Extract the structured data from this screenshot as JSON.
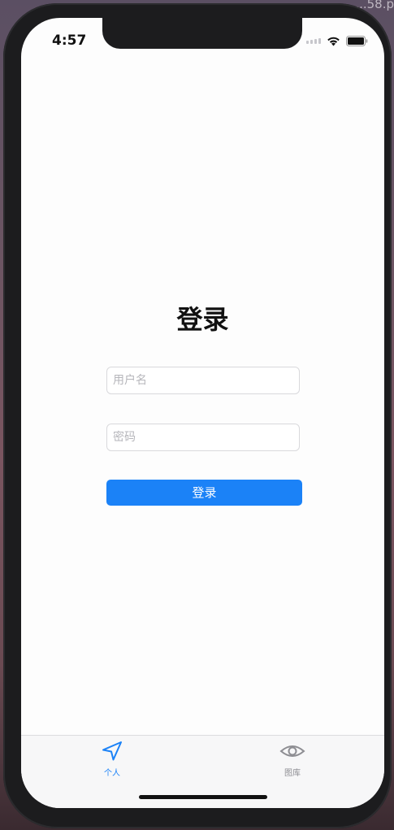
{
  "status_bar": {
    "time": "4:57"
  },
  "window_corner_text": "...58.p",
  "login": {
    "title": "登录",
    "username_placeholder": "用户名",
    "password_placeholder": "密码",
    "submit_label": "登录"
  },
  "tab_bar": {
    "tabs": [
      {
        "label": "个人",
        "icon": "location-arrow-icon",
        "selected": true
      },
      {
        "label": "图库",
        "icon": "eye-icon",
        "selected": false
      }
    ]
  },
  "colors": {
    "accent": "#1b82f7",
    "tab_selected": "#1b82f7",
    "tab_unselected": "#8e8e93"
  }
}
